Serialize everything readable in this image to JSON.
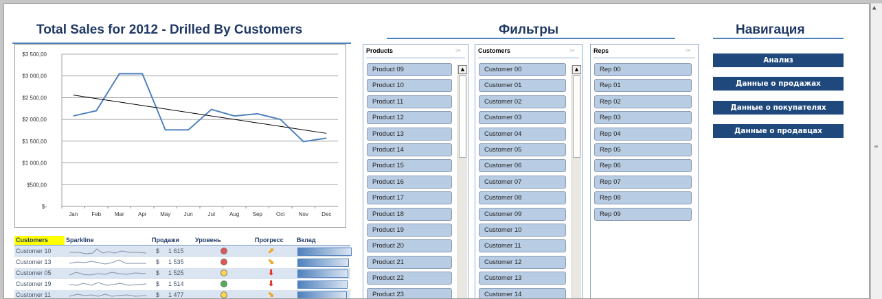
{
  "titles": {
    "main": "Total Sales for 2012 - Drilled By Customers",
    "filters": "Фильтры",
    "navigation": "Навигация"
  },
  "chart_data": {
    "type": "line",
    "categories": [
      "Jan",
      "Feb",
      "Mar",
      "Apr",
      "May",
      "Jun",
      "Jul",
      "Aug",
      "Sep",
      "Oct",
      "Nov",
      "Dec"
    ],
    "series": [
      {
        "values": [
          2080,
          2200,
          3050,
          3050,
          1760,
          1760,
          2230,
          2080,
          2130,
          2000,
          1490,
          1570
        ],
        "color": "#4f81bd"
      },
      {
        "values": [
          2560,
          2480,
          2400,
          2320,
          2240,
          2160,
          2080,
          2000,
          1920,
          1840,
          1760,
          1680
        ],
        "color": "#000000"
      }
    ],
    "yticks": [
      "$3 500,00",
      "$3 000,00",
      "$2 500,00",
      "$2 000,00",
      "$1 500,00",
      "$1 000,00",
      "$500,00",
      "$-"
    ],
    "ylim": [
      0,
      3500
    ],
    "grid": true,
    "legend": false
  },
  "table": {
    "headers": {
      "customers": "Customers",
      "sparkline": "Sparkline",
      "sales": "Продажи",
      "level": "Уровень",
      "progress": "Прогресс",
      "share": "Вклад"
    },
    "rows": [
      {
        "customer": "Customer 10",
        "currency": "$",
        "sales": "1 615",
        "level": "red",
        "trend": "up-right",
        "share": 1.0
      },
      {
        "customer": "Customer 13",
        "currency": "$",
        "sales": "1 535",
        "level": "red",
        "trend": "down-right",
        "share": 0.95
      },
      {
        "customer": "Customer 05",
        "currency": "$",
        "sales": "1 525",
        "level": "yellow",
        "trend": "down",
        "share": 0.94
      },
      {
        "customer": "Customer 19",
        "currency": "$",
        "sales": "1 514",
        "level": "green",
        "trend": "down",
        "share": 0.93
      },
      {
        "customer": "Customer 11",
        "currency": "$",
        "sales": "1 477",
        "level": "yellow",
        "trend": "down-right",
        "share": 0.91
      }
    ]
  },
  "slicers": {
    "products": {
      "title": "Products",
      "items": [
        "Product 09",
        "Product 10",
        "Product 11",
        "Product 12",
        "Product 13",
        "Product 14",
        "Product 15",
        "Product 16",
        "Product 17",
        "Product 18",
        "Product 19",
        "Product 20",
        "Product 21",
        "Product 22",
        "Product 23"
      ]
    },
    "customers": {
      "title": "Customers",
      "items": [
        "Customer 00",
        "Customer 01",
        "Customer 02",
        "Customer 03",
        "Customer 04",
        "Customer 05",
        "Customer 06",
        "Customer 07",
        "Customer 08",
        "Customer 09",
        "Customer 10",
        "Customer 11",
        "Customer 12",
        "Customer 13",
        "Customer 14"
      ]
    },
    "reps": {
      "title": "Reps",
      "items": [
        "Rep 00",
        "Rep 01",
        "Rep 02",
        "Rep 03",
        "Rep 04",
        "Rep 05",
        "Rep 06",
        "Rep 07",
        "Rep 08",
        "Rep 09"
      ]
    }
  },
  "nav": [
    "Анализ",
    "Данные о продажах",
    "Данные о покупателях",
    "Данные о продавцах"
  ],
  "colors": {
    "accent": "#4f81bd",
    "nav_button": "#1f497d",
    "slicer_item": "#b8cce4",
    "highlight": "#ffff00"
  }
}
